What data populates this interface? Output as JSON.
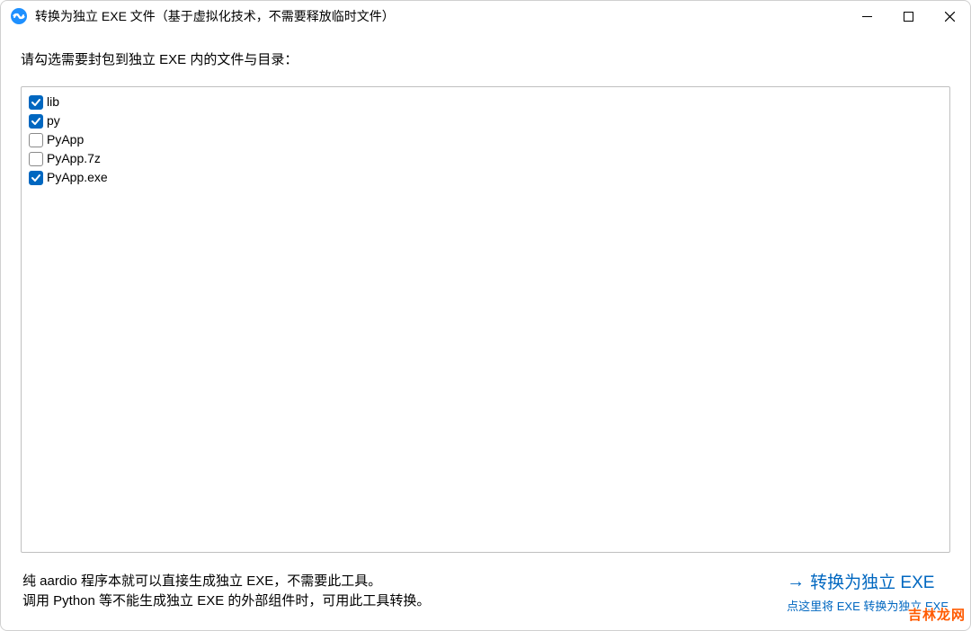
{
  "window": {
    "title": "转换为独立 EXE 文件（基于虚拟化技术，不需要释放临时文件）"
  },
  "instruction": "请勾选需要封包到独立 EXE 内的文件与目录：",
  "files": [
    {
      "label": "lib",
      "checked": true
    },
    {
      "label": "py",
      "checked": true
    },
    {
      "label": "PyApp",
      "checked": false
    },
    {
      "label": "PyApp.7z",
      "checked": false
    },
    {
      "label": "PyApp.exe",
      "checked": true
    }
  ],
  "footer": {
    "line1": "纯 aardio 程序本就可以直接生成独立 EXE，不需要此工具。",
    "line2": "调用 Python 等不能生成独立 EXE 的外部组件时，可用此工具转换。"
  },
  "action": {
    "title": "转换为独立 EXE",
    "subtitle": "点这里将 EXE 转换为独立 EXE"
  },
  "watermark": "吉林龙网"
}
